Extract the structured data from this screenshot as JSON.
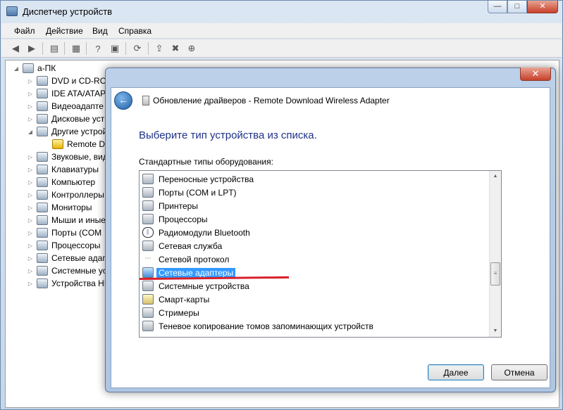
{
  "device_manager": {
    "title": "Диспетчер устройств",
    "caption": {
      "minimize": "—",
      "maximize": "□",
      "close": "✕"
    },
    "menu": [
      "Файл",
      "Действие",
      "Вид",
      "Справка"
    ],
    "toolbar_icons": [
      "back-arrow-icon",
      "forward-arrow-icon",
      "properties-icon",
      "tree-icon",
      "help-icon",
      "monitor-icon",
      "update-driver-icon",
      "uninstall-icon",
      "scan-hardware-icon"
    ],
    "tree": {
      "root": "а-ПК",
      "items": [
        "DVD и CD-ROM",
        "IDE ATA/ATAP",
        "Видеоадапте",
        "Дисковые устр",
        "Другие устрой",
        "Remote Do",
        "Звуковые, вид",
        "Клавиатуры",
        "Компьютер",
        "Контроллеры",
        "Мониторы",
        "Мыши и иные",
        "Порты (COM",
        "Процессоры",
        "Сетевые адапт",
        "Системные уст",
        "Устройства HI"
      ]
    }
  },
  "dialog": {
    "close": "✕",
    "back": "←",
    "title": "Обновление драйверов - Remote Download Wireless Adapter",
    "heading": "Выберите тип устройства из списка.",
    "list_label": "Стандартные типы оборудования:",
    "items": [
      {
        "label": "Переносные устройства",
        "icon": "portable-device-icon"
      },
      {
        "label": "Порты (COM и LPT)",
        "icon": "port-icon"
      },
      {
        "label": "Принтеры",
        "icon": "printer-icon"
      },
      {
        "label": "Процессоры",
        "icon": "processor-icon"
      },
      {
        "label": "Радиомодули Bluetooth",
        "icon": "bluetooth-icon"
      },
      {
        "label": "Сетевая служба",
        "icon": "network-service-icon"
      },
      {
        "label": "Сетевой протокол",
        "icon": "network-protocol-icon"
      },
      {
        "label": "Сетевые адаптеры",
        "icon": "network-adapter-icon",
        "selected": true
      },
      {
        "label": "Системные устройства",
        "icon": "system-device-icon"
      },
      {
        "label": "Смарт-карты",
        "icon": "smart-card-icon"
      },
      {
        "label": "Стримеры",
        "icon": "tape-drive-icon"
      },
      {
        "label": "Теневое копирование томов запоминающих устройств",
        "icon": "storage-volume-icon"
      }
    ],
    "next_button": "Далее",
    "cancel_button": "Отмена",
    "highlight_color": "#3399ff",
    "annotation_color": "#d8202a"
  }
}
